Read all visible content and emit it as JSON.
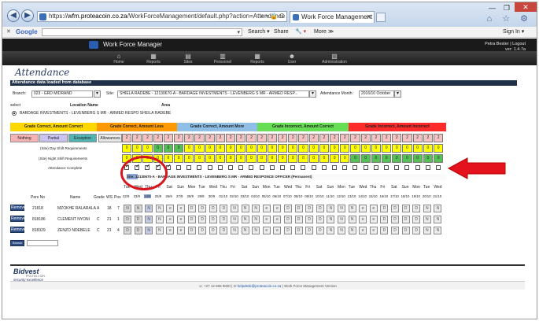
{
  "browser": {
    "address_prefix": "https://",
    "address_host": "wfm.proteacoin.co.za",
    "address_path": "/WorkForceManagement/default.php?action=Attendance",
    "address_controls": "⌕ ▾ 🔒 C",
    "tab_title": "Work Force Management",
    "tab_close": "✕",
    "window_controls": [
      "—",
      "❐"
    ],
    "window_close": "✕",
    "system_icons": "⌂ ☆ ⚙"
  },
  "toolbar": {
    "close_glyph": "✕",
    "logo": "Google",
    "search_label": "Search ▾",
    "share_label": "Share",
    "more_label": "More ≫",
    "sign_in": "Sign In ▾",
    "wrench": "🔧 ▾"
  },
  "app": {
    "title": "Work Force Manager",
    "user_line": "Petra Bester | Logout",
    "version": "ver: 1.4.7a",
    "menu": [
      {
        "label": "Home",
        "icon": "⌂"
      },
      {
        "label": "Reports",
        "icon": "▦"
      },
      {
        "label": "Sites",
        "icon": "▤"
      },
      {
        "label": "Personnel",
        "icon": "▥"
      },
      {
        "label": "Reports",
        "icon": "▦"
      },
      {
        "label": "User",
        "icon": "☻"
      },
      {
        "label": "Administration",
        "icon": "▧"
      }
    ]
  },
  "page": {
    "heading": "Attendance",
    "status_bar": "Attendance data loaded from database"
  },
  "filters": {
    "branch_label": "Branch:",
    "branch_value": "023 - GRD MIDRAND",
    "site_label": "Site:",
    "site_value": "SHIELA RADEBE - 12130670-A - BARDAGE INVESTMENTS - LEVENBERG S MR - ARMED RESP...",
    "month_label": "Attendance Month:",
    "month_value": "2016/10 October"
  },
  "location": {
    "select_label": "select",
    "location_label": "Location Name",
    "area_label": "Area",
    "site_line": "BARDAGE INVESTMENTS - LEVENBERG S MR - ARMED RESPO SHEILA RADEBE"
  },
  "legend": {
    "row1": [
      {
        "label": "Grade Correct, Amount Correct",
        "color": "#ffd700"
      },
      {
        "label": "Grade Correct, Amount Less",
        "color": "#ff9900"
      },
      {
        "label": "Grade Correct, Amount More",
        "color": "#8fbfe7"
      },
      {
        "label": "Grade Incorrect, Amount Correct",
        "color": "#66dd55"
      },
      {
        "label": "Grade Incorrect, Amount Incorrect",
        "color": "#ff2a2a"
      }
    ],
    "row2": [
      {
        "label": "Nothing",
        "color": "#f5b3b3"
      },
      {
        "label": "Partial",
        "color": "#c9c4ef"
      },
      {
        "label": "Exception",
        "color": "#53b2b2"
      },
      {
        "label": "Allowances",
        "color": "#e8e8e8"
      }
    ]
  },
  "requirements": {
    "day_label": "(Site) Day Shift Requirements",
    "night_label": "(Site) Night Shift Requirements",
    "complete_label": "Attendance Complete",
    "top_values": [
      "2",
      "2",
      "2",
      "2",
      "2",
      "2",
      "2",
      "2",
      "2",
      "2",
      "2",
      "2",
      "2",
      "2",
      "2",
      "2",
      "2",
      "2",
      "2",
      "2",
      "2",
      "2",
      "2",
      "2",
      "2",
      "2",
      "2",
      "2",
      "2",
      "2",
      "2"
    ],
    "day_values": [
      "0",
      "0",
      "0",
      "0",
      "0",
      "0",
      "0",
      "0",
      "0",
      "0",
      "0",
      "0",
      "0",
      "0",
      "0",
      "0",
      "0",
      "0",
      "0",
      "0",
      "0",
      "0",
      "0",
      "0",
      "0",
      "0",
      "0",
      "0",
      "0",
      "0",
      "0"
    ],
    "night_values": [
      "0",
      "0",
      "0",
      "0",
      "0",
      "0",
      "0",
      "0",
      "0",
      "0",
      "0",
      "0",
      "0",
      "0",
      "0",
      "0",
      "0",
      "0",
      "0",
      "0",
      "0",
      "0",
      "0",
      "0",
      "0",
      "0",
      "0",
      "0",
      "0",
      "0",
      "0"
    ],
    "top_colors": [
      "#f3c2c2",
      "#f3c2c2",
      "#f3c2c2",
      "#f3c2c2",
      "#f3c2c2",
      "#f3c2c2",
      "#f3c2c2",
      "#f3c2c2",
      "#f3c2c2",
      "#f3c2c2",
      "#f3c2c2",
      "#f3c2c2",
      "#f3c2c2",
      "#f3c2c2",
      "#f3c2c2",
      "#f3c2c2",
      "#f3c2c2",
      "#f3c2c2",
      "#f3c2c2",
      "#f3c2c2",
      "#f3c2c2",
      "#f3c2c2",
      "#f3c2c2",
      "#f3c2c2",
      "#f3c2c2",
      "#f3c2c2",
      "#f3c2c2",
      "#f3c2c2",
      "#f3c2c2",
      "#f3c2c2",
      "#f3c2c2"
    ],
    "day_colors": [
      "#ffff00",
      "#ffff00",
      "#ffff00",
      "#55c055",
      "#55c055",
      "#55c055",
      "#ffff00",
      "#ffff00",
      "#ffff00",
      "#ffff00",
      "#ffff00",
      "#ffff00",
      "#ffff00",
      "#ffff00",
      "#ffff00",
      "#ffff00",
      "#ffff00",
      "#ffff00",
      "#ffff00",
      "#ffff00",
      "#ffff00",
      "#ffff00",
      "#ffff00",
      "#ffff00",
      "#ffff00",
      "#ffff00",
      "#ffff00",
      "#ffff00",
      "#ffff00",
      "#ffff00",
      "#ffff00"
    ],
    "night_colors": [
      "#ffff00",
      "#ffff00",
      "#ffff00",
      "#ffff00",
      "#ffff00",
      "#ffff00",
      "#ffff00",
      "#ffff00",
      "#ffff00",
      "#ffff00",
      "#ffff00",
      "#ffff00",
      "#ffff00",
      "#ffff00",
      "#ffff00",
      "#ffff00",
      "#ffff00",
      "#ffff00",
      "#ffff00",
      "#ffff00",
      "#ffff00",
      "#ffff00",
      "#55c055",
      "#55c055",
      "#55c055",
      "#55c055",
      "#55c055",
      "#55c055",
      "#55c055",
      "#55c055",
      "#55c055"
    ],
    "complete_checked": [
      true,
      true,
      true,
      true,
      true,
      false,
      false,
      false,
      false,
      false,
      false,
      false,
      false,
      false,
      false,
      false,
      false,
      false,
      false,
      false,
      false,
      false,
      false,
      false,
      false,
      false,
      false,
      false,
      false,
      false,
      false
    ]
  },
  "officers": {
    "site_header": "Site: 12130670-A - BARDAGE INVESTMENTS - LEVENBERG S MR - ARMED RESPONCE OFFICER (Permanent)",
    "columns": [
      "Pers No",
      "Name",
      "Grade",
      "WS",
      "Pos"
    ],
    "days": [
      "Tue",
      "Wed",
      "Thu",
      "Fri",
      "Sat",
      "Sun",
      "Mon",
      "Tue",
      "Wed",
      "Thu",
      "Fri",
      "Sat",
      "Sun",
      "Mon",
      "Tue",
      "Wed",
      "Thu",
      "Fri",
      "Sat",
      "Sun",
      "Mon",
      "Tue",
      "Wed",
      "Thu",
      "Fri",
      "Sat",
      "Sun",
      "Mon",
      "Tue",
      "Wed"
    ],
    "dates": [
      "22/9",
      "23/9",
      "24/9",
      "25/9",
      "26/9",
      "27/9",
      "28/9",
      "29/9",
      "30/9",
      "01/10",
      "02/10",
      "03/10",
      "04/10",
      "05/10",
      "06/10",
      "07/10",
      "08/10",
      "09/10",
      "10/10",
      "11/10",
      "12/10",
      "13/10",
      "14/10",
      "15/10",
      "16/10",
      "17/10",
      "18/10",
      "19/10",
      "20/10",
      "21/10"
    ],
    "remove_label": "Remove",
    "search_label": "Search",
    "rows": [
      {
        "pers_no": "21818",
        "name": "MZOKHE RALARALA",
        "grade": "A",
        "ws": "18",
        "pos": "7",
        "cells": [
          "N",
          "N",
          "N",
          "N",
          "e",
          "e",
          "D",
          "D",
          "D",
          "D",
          "N",
          "N",
          "N",
          "e",
          "e",
          "D",
          "D",
          "D",
          "D",
          "N",
          "N",
          "N",
          "e",
          "e",
          "D",
          "D",
          "D",
          "D",
          "N",
          "N"
        ]
      },
      {
        "pers_no": "818186",
        "name": "CLEMENT NYONI",
        "grade": "C",
        "ws": "21",
        "pos": "1",
        "cells": [
          "D",
          "D",
          "N",
          "N",
          "e",
          "e",
          "D",
          "D",
          "D",
          "D",
          "N",
          "N",
          "N",
          "e",
          "e",
          "D",
          "D",
          "D",
          "D",
          "N",
          "N",
          "N",
          "e",
          "e",
          "D",
          "D",
          "D",
          "D",
          "N",
          "N"
        ]
      },
      {
        "pers_no": "818329",
        "name": "ZENZO NDEBELE",
        "grade": "C",
        "ws": "21",
        "pos": "4",
        "cells": [
          "D",
          "D",
          "N",
          "N",
          "e",
          "e",
          "D",
          "D",
          "D",
          "D",
          "N",
          "N",
          "N",
          "e",
          "e",
          "D",
          "D",
          "D",
          "D",
          "N",
          "N",
          "N",
          "e",
          "e",
          "D",
          "D",
          "D",
          "D",
          "N",
          "N"
        ]
      }
    ]
  },
  "footer": {
    "brand": "Bidvest",
    "brand_sub": "PROTEA COIN",
    "tagline": "security excellence",
    "phone": "+27 12 665 9000",
    "email": "helpdesk@proteacoin.co.za",
    "suffix": "Work Force Management Version"
  },
  "colors": {
    "accent_red": "#d8141d",
    "header_dark": "#1f3048",
    "button_blue": "#2d4d86"
  }
}
